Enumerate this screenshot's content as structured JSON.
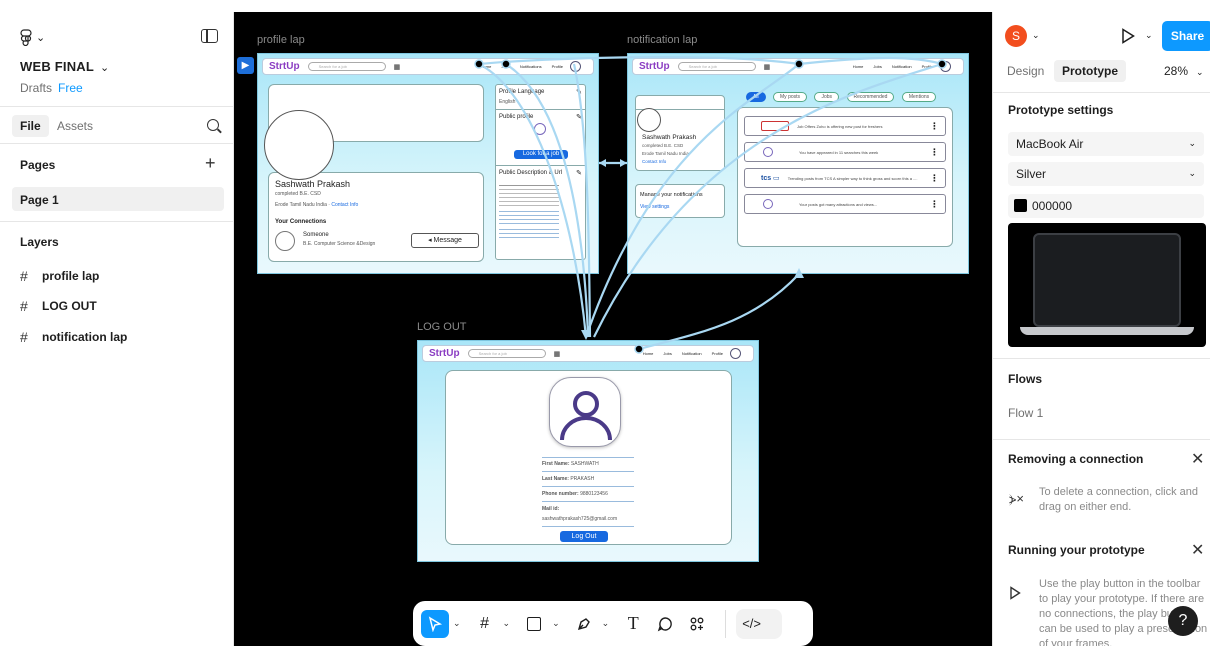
{
  "left_panel": {
    "file_name": "WEB FINAL",
    "location": "Drafts",
    "plan": "Free",
    "tabs": [
      "File",
      "Assets"
    ],
    "pages_heading": "Pages",
    "pages": [
      "Page 1"
    ],
    "layers_heading": "Layers",
    "layers": [
      "profile lap",
      "LOG OUT",
      "notification lap"
    ]
  },
  "canvas": {
    "frames": {
      "profile": {
        "label": "profile lap",
        "brand": "StrtUp",
        "search_placeholder": "Search for a job",
        "nav": [
          "Home",
          "Jobs",
          "Notifications",
          "Profile"
        ],
        "name": "Sashwath Prakash",
        "degree": "completed B.E. CSD",
        "location": "Erode Tamil Nadu India",
        "contact": "Contact Info",
        "connections_heading": "Your Connections",
        "connection_name": "Someone",
        "connection_detail": "B.E. Computer Science &Design",
        "message_btn": "Message",
        "profile_language": "Profile Language",
        "language_value": "English",
        "public_profile": "Public profile",
        "look_job_btn": "Look for a job",
        "public_desc": "Public Description & Url"
      },
      "notification": {
        "label": "notification lap",
        "brand": "StrtUp",
        "search_placeholder": "Search for a job",
        "nav": [
          "Home",
          "Jobs",
          "Notification",
          "Profile"
        ],
        "name": "Sashwath Prakash",
        "degree": "completed B.E. CSD",
        "location": "Erode Tamil Nadu India",
        "contact": "Contact Info",
        "manage_heading": "Manage your notifications",
        "view_settings": "View settings",
        "filters": [
          "All",
          "My posts",
          "Jobs",
          "Recommended",
          "Mentions"
        ],
        "items": [
          "Job Offers Zoho is offering new post for freshers",
          "You have appeared in 11 searches this week",
          "Trending posts from TCS A simpler way to think gross and scorn this a ....",
          "Your posts got many attractions and views..."
        ]
      },
      "logout": {
        "label": "LOG OUT",
        "brand": "StrtUp",
        "search_placeholder": "Search for a job",
        "nav": [
          "Home",
          "Jobs",
          "Notification",
          "Profile"
        ],
        "fields": [
          {
            "label": "First Name:",
            "value": "SASHWATH"
          },
          {
            "label": "Last Name:",
            "value": "PRAKASH"
          },
          {
            "label": "Phone number:",
            "value": "9880123456"
          },
          {
            "label": "Mail id:",
            "value": "sashwathprakash725@gmail.com"
          }
        ],
        "logout_btn": "Log Out"
      }
    }
  },
  "toolbar": {
    "tools": [
      "move-tool",
      "frame-tool",
      "shape-tool",
      "pen-tool",
      "text-tool",
      "comment-tool",
      "actions-tool",
      "dev-mode"
    ]
  },
  "right_panel": {
    "avatar_initial": "S",
    "share_label": "Share",
    "tabs": [
      "Design",
      "Prototype"
    ],
    "zoom": "28%",
    "prototype_settings_heading": "Prototype settings",
    "device": "MacBook Air",
    "device_color": "Silver",
    "background_hex": "000000",
    "flows_heading": "Flows",
    "flow_name": "Flow 1",
    "removing_heading": "Removing a connection",
    "removing_text": "To delete a connection, click and drag on either end.",
    "running_heading": "Running your prototype",
    "running_text": "Use the play button in the toolbar to play your prototype. If there are no connections, the play button can be used to play a presentation of your frames."
  },
  "colors": {
    "accent": "#0d99ff",
    "avatar": "#f24e1e",
    "connection": "#a9d8f2",
    "link_blue": "#1769e0"
  }
}
